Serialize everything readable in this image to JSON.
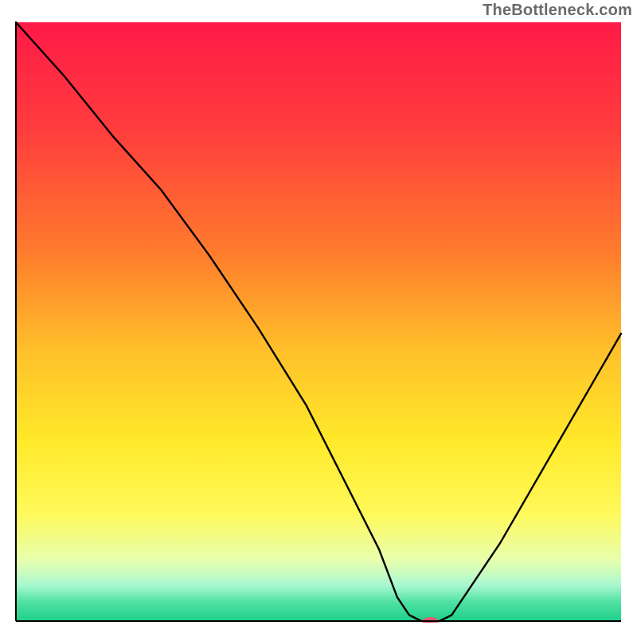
{
  "watermark": "TheBottleneck.com",
  "chart_data": {
    "type": "line",
    "title": "",
    "xlabel": "",
    "ylabel": "",
    "xlim": [
      0,
      100
    ],
    "ylim": [
      0,
      100
    ],
    "background_gradient": [
      {
        "offset": 0.0,
        "color": "#ff1a47"
      },
      {
        "offset": 0.18,
        "color": "#ff3d3d"
      },
      {
        "offset": 0.38,
        "color": "#ff7a2d"
      },
      {
        "offset": 0.55,
        "color": "#ffc12a"
      },
      {
        "offset": 0.7,
        "color": "#ffe92a"
      },
      {
        "offset": 0.82,
        "color": "#fff95a"
      },
      {
        "offset": 0.9,
        "color": "#e6ffb0"
      },
      {
        "offset": 0.94,
        "color": "#a8f8cf"
      },
      {
        "offset": 0.97,
        "color": "#4ce0a0"
      },
      {
        "offset": 1.0,
        "color": "#1fd08a"
      }
    ],
    "series": [
      {
        "name": "bottleneck-curve",
        "x": [
          0,
          8,
          16,
          24,
          32,
          40,
          48,
          55,
          60,
          63,
          65,
          67,
          70,
          72,
          80,
          88,
          96,
          100
        ],
        "y": [
          100,
          91,
          81,
          72,
          61,
          49,
          36,
          22,
          12,
          4,
          1,
          0,
          0,
          1,
          13,
          27,
          41,
          48
        ]
      }
    ],
    "marker": {
      "name": "optimal-marker",
      "x": 68.5,
      "y": 0,
      "rx": 10,
      "ry": 5,
      "color": "#e05a6a"
    },
    "axes": {
      "color": "#000000",
      "width": 2
    }
  }
}
